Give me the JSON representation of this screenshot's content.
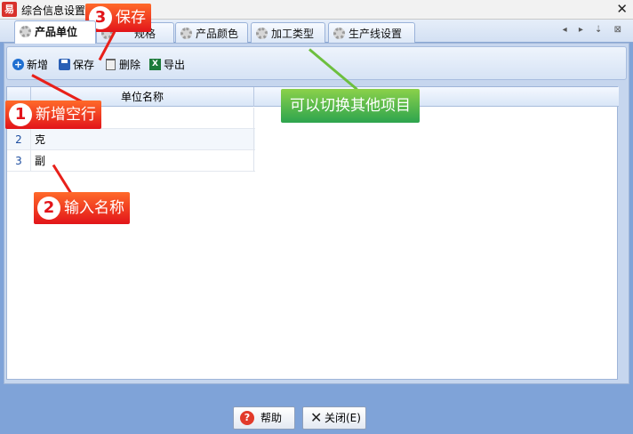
{
  "window": {
    "title": "综合信息设置",
    "app_icon": "易",
    "close_glyph": "✕"
  },
  "tabs": [
    {
      "label": "产品单位",
      "active": true
    },
    {
      "label": "规格",
      "active": false
    },
    {
      "label": "产品颜色",
      "active": false
    },
    {
      "label": "加工类型",
      "active": false
    },
    {
      "label": "生产线设置",
      "active": false
    }
  ],
  "tab_nav": "◂ ▸ ⇣ ⊠",
  "toolbar": {
    "add": "新增",
    "save": "保存",
    "delete": "删除",
    "export": "导出"
  },
  "grid": {
    "column_header": "单位名称",
    "rows": [
      {
        "num": "",
        "name": ""
      },
      {
        "num": "2",
        "name": "克"
      },
      {
        "num": "3",
        "name": "副"
      }
    ]
  },
  "footer": {
    "help": "帮助",
    "close": "关闭(E)"
  },
  "callouts": [
    {
      "num": "1",
      "text": "新增空行"
    },
    {
      "num": "2",
      "text": "输入名称"
    },
    {
      "num": "3",
      "text": "保存"
    },
    {
      "text": "可以切换其他项目"
    }
  ],
  "colors": {
    "background": "#7fa3d8",
    "callout_red": "#e2141a",
    "callout_green": "#2da44e",
    "accent_blue": "#1f6fd1"
  }
}
